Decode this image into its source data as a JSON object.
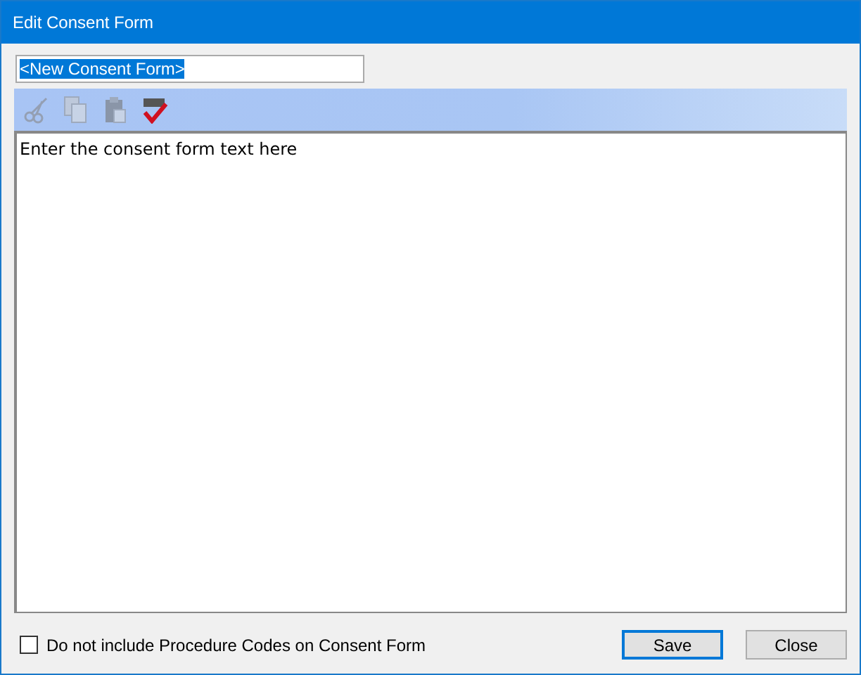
{
  "window": {
    "title": "Edit Consent Form"
  },
  "name_field": {
    "value": "<New Consent Form>",
    "selected": true
  },
  "toolbar": [
    {
      "kind": "cut",
      "disabled": true
    },
    {
      "kind": "copy",
      "disabled": true
    },
    {
      "kind": "paste",
      "disabled": true
    },
    {
      "kind": "spellcheck",
      "disabled": false
    }
  ],
  "editor": {
    "value": "Enter the consent form text here"
  },
  "option": {
    "label": "Do not include Procedure Codes on Consent Form",
    "checked": false
  },
  "buttons": [
    {
      "label": "Save",
      "selected": true
    },
    {
      "label": "Close",
      "selected": false
    }
  ]
}
